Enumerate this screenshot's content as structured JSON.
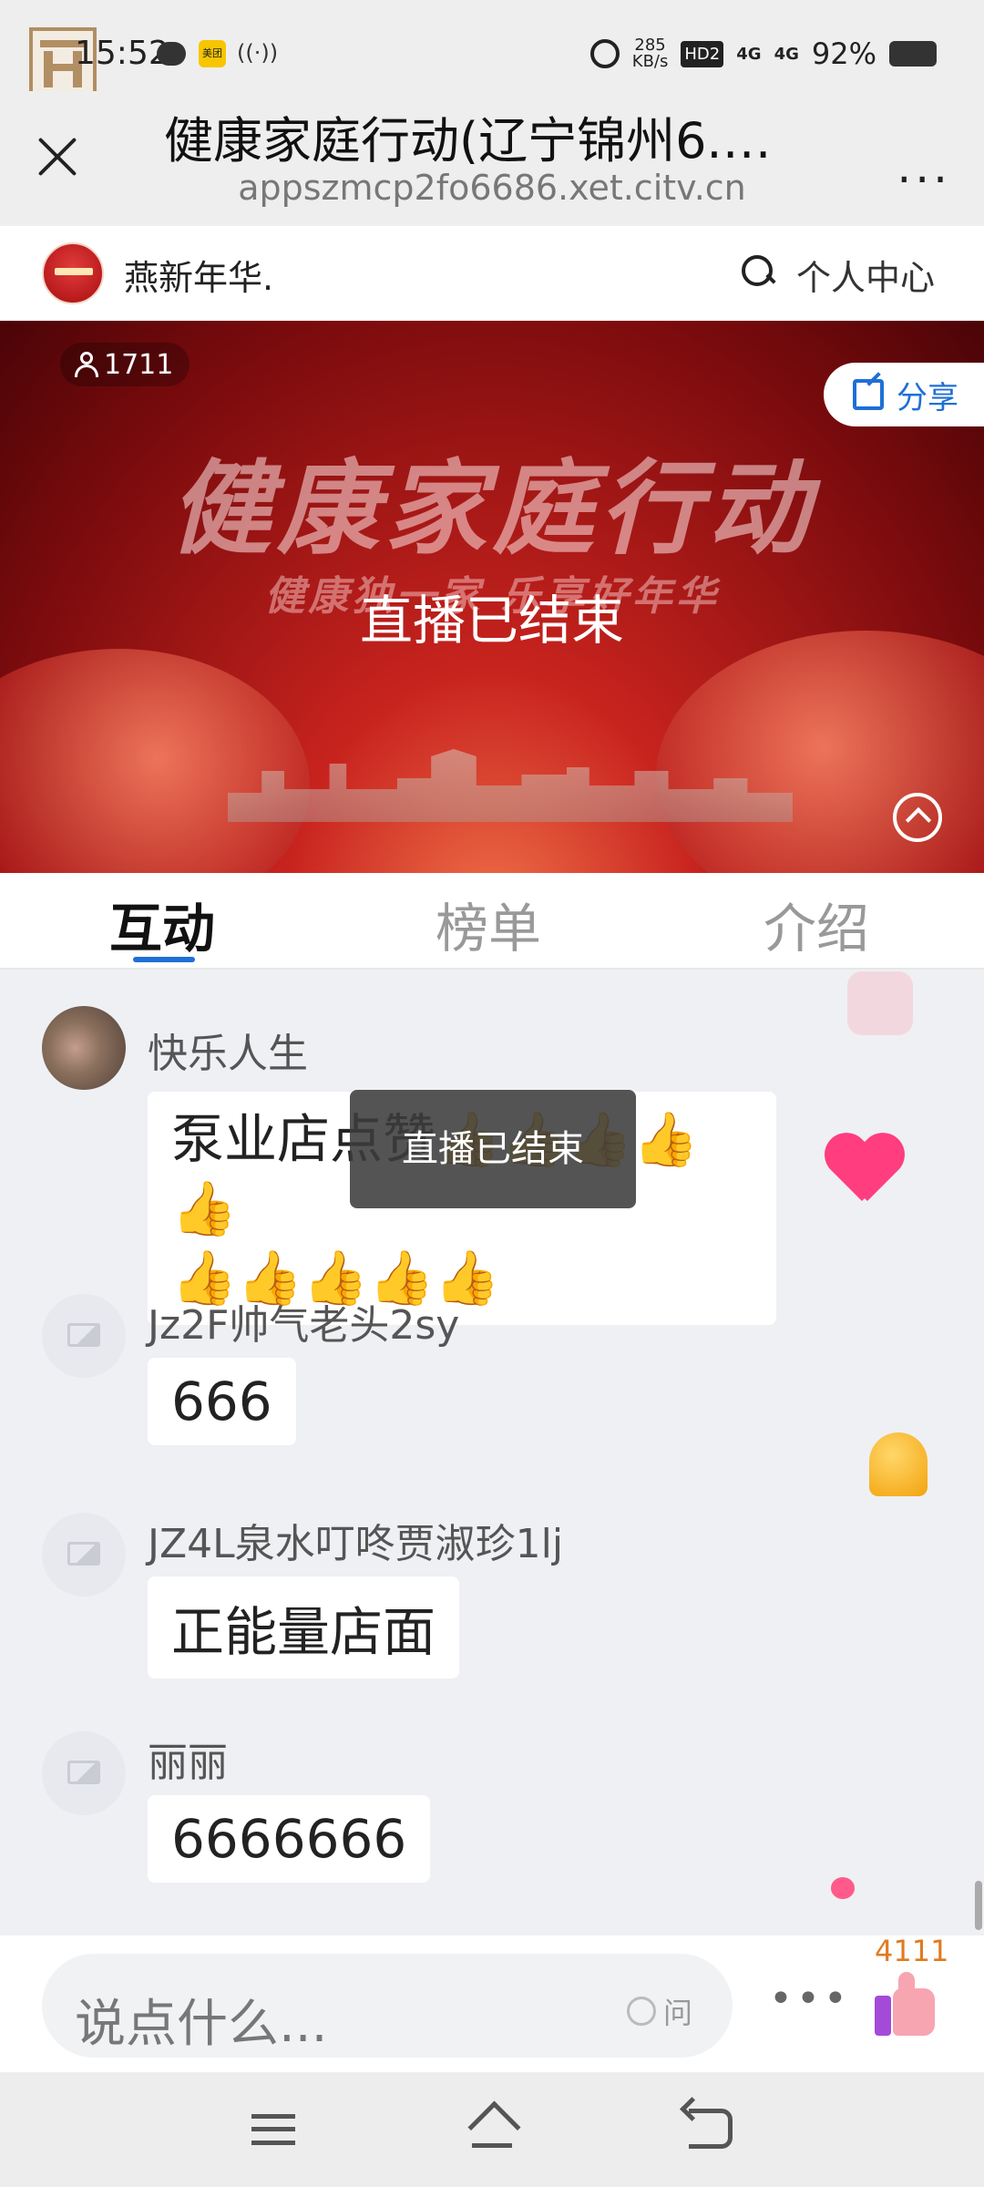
{
  "status_bar": {
    "time": "15:52",
    "meituan_label": "美团",
    "net_speed": "285\nKB/s",
    "hd_label": "HD2",
    "signal1": "4G",
    "signal2": "4G",
    "battery": "92%"
  },
  "title_bar": {
    "title": "健康家庭行动(辽宁锦州6.…",
    "url": "appszmcp2fo6686.xet.citv.cn",
    "more_label": "..."
  },
  "site_header": {
    "name": "燕新年华.",
    "personal_center": "个人中心"
  },
  "video": {
    "viewer_count": "1711",
    "banner_title": "健康家庭行动",
    "banner_subtitle": "健康独一家 乐享好年华",
    "status": "直播已结束",
    "share_label": "分享"
  },
  "tabs": [
    {
      "label": "互动",
      "active": true
    },
    {
      "label": "榜单",
      "active": false
    },
    {
      "label": "介绍",
      "active": false
    }
  ],
  "messages": [
    {
      "user": "快乐人生",
      "text_line1": "泵业店点赞👍👍👍👍👍",
      "text_line2": "👍👍👍👍👍"
    },
    {
      "user": "Jz2F帅气老头2sy",
      "text": "666"
    },
    {
      "user": "JZ4L泉水叮咚贾淑珍1lj",
      "text": "正能量店面"
    },
    {
      "user": "丽丽",
      "text": "6666666"
    }
  ],
  "toast": "直播已结束",
  "input_bar": {
    "placeholder": "说点什么...",
    "ask_label": "问",
    "more_label": "•••",
    "like_count": "4111"
  }
}
